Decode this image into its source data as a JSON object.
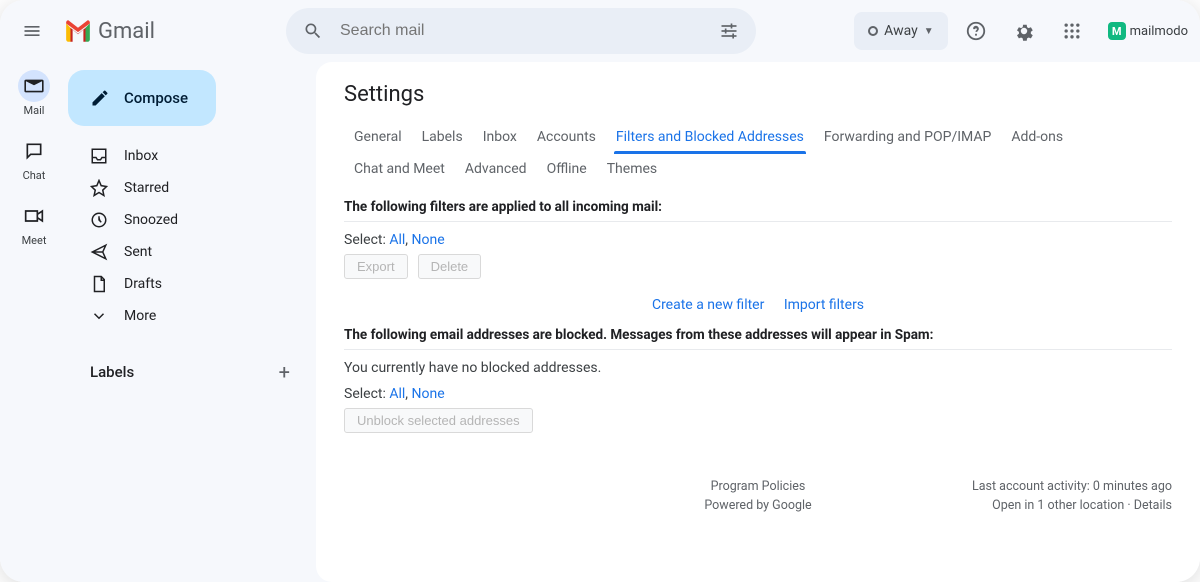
{
  "header": {
    "app_name": "Gmail",
    "search_placeholder": "Search mail",
    "status_label": "Away",
    "brand_name": "mailmodo"
  },
  "rail": {
    "items": [
      {
        "label": "Mail"
      },
      {
        "label": "Chat"
      },
      {
        "label": "Meet"
      }
    ]
  },
  "sidebar": {
    "compose_label": "Compose",
    "links": [
      {
        "label": "Inbox"
      },
      {
        "label": "Starred"
      },
      {
        "label": "Snoozed"
      },
      {
        "label": "Sent"
      },
      {
        "label": "Drafts"
      },
      {
        "label": "More"
      }
    ],
    "labels_title": "Labels"
  },
  "settings": {
    "page_title": "Settings",
    "tabs": {
      "general": "General",
      "labels": "Labels",
      "inbox": "Inbox",
      "accounts": "Accounts",
      "filters": "Filters and Blocked Addresses",
      "forwarding": "Forwarding and POP/IMAP",
      "addons": "Add-ons",
      "chatmeet": "Chat and Meet",
      "advanced": "Advanced",
      "offline": "Offline",
      "themes": "Themes"
    },
    "filters_heading": "The following filters are applied to all incoming mail:",
    "select_prefix": "Select: ",
    "select_all": "All",
    "select_none": "None",
    "export_btn": "Export",
    "delete_btn": "Delete",
    "create_filter": "Create a new filter",
    "import_filters": "Import filters",
    "blocked_heading": "The following email addresses are blocked. Messages from these addresses will appear in Spam:",
    "no_blocked": "You currently have no blocked addresses.",
    "unblock_btn": "Unblock selected addresses"
  },
  "footer": {
    "policies": "Program Policies",
    "powered": "Powered by Google",
    "activity": "Last account activity: 0 minutes ago",
    "open_loc": "Open in 1 other location · Details"
  }
}
